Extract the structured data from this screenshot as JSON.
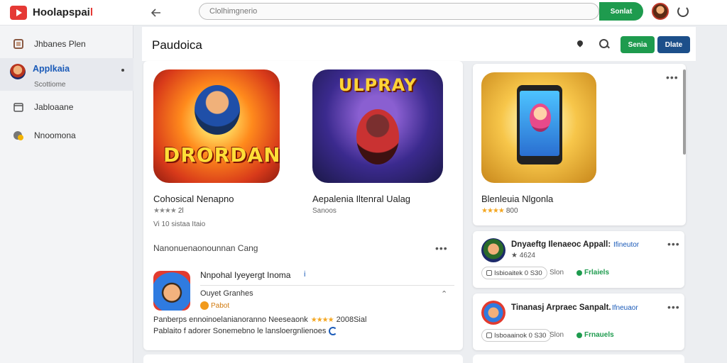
{
  "app": {
    "name_main": "Hoolapspai",
    "name_accent": "l"
  },
  "sidebar": {
    "items": [
      {
        "label": "Jhbanes Plen",
        "icon": "grid-icon"
      },
      {
        "label": "Applkaia",
        "sub": "Scottiome",
        "icon": "avatar-icon",
        "active": true
      },
      {
        "label": "Jabloaane",
        "icon": "calendar-icon"
      },
      {
        "label": "Nnoomona",
        "icon": "pie-icon"
      }
    ]
  },
  "topbar": {
    "search_placeholder": "Clolhimgnerio",
    "search_button": "Sonlat"
  },
  "header": {
    "title": "Paudoica",
    "btn_green": "Senia",
    "btn_navy": "Dlate"
  },
  "cards": [
    {
      "title": "Cohosical Nenapno",
      "stars": "★★★★",
      "rating": "2l",
      "meta": "Vi 10 sistaa Itaio",
      "art_text": "DRORDAN"
    },
    {
      "title": "Aepalenia Iltenral Ualag",
      "meta": "Sanoos",
      "art_text": "ULPRAY"
    },
    {
      "title": "Blenleuia Nlgonla",
      "stars": "★★★★",
      "rating": "800"
    }
  ],
  "section": {
    "title": "Nanonuenaonounnan Cang",
    "list_item": {
      "title": "Nnpohal Iyeyergt Inoma",
      "title_info": "i",
      "sub": "Ouyet Granhes",
      "tag": "Pabot",
      "desc1": "Panberps ennoinoelanianoranno Neeseaonk",
      "desc1_stars": "★★★★",
      "desc1_rating": "2008Sial",
      "desc2": "Pablaito f adorer Sonemebno le lansloergnlienoes"
    }
  },
  "right_list": [
    {
      "title": "Dnyaeftg Ilenaeoc Appall:",
      "title_info": "Ifineutor",
      "sub": "★ 4624",
      "pill": "Isbioaitek 0 S30",
      "status": "Slon",
      "green": "Frlaiels"
    },
    {
      "title": "Tinanasj Arpraec Sanpalt.",
      "title_info": "Ifneuaor",
      "sub": "",
      "pill": "Isboaainok 0 S30",
      "status": "Slon",
      "green": "Frnauels"
    }
  ],
  "colors": {
    "green": "#1e9b4e",
    "navy": "#1c4f8a",
    "brand_red": "#e53935",
    "link_blue": "#1a5ab8"
  }
}
